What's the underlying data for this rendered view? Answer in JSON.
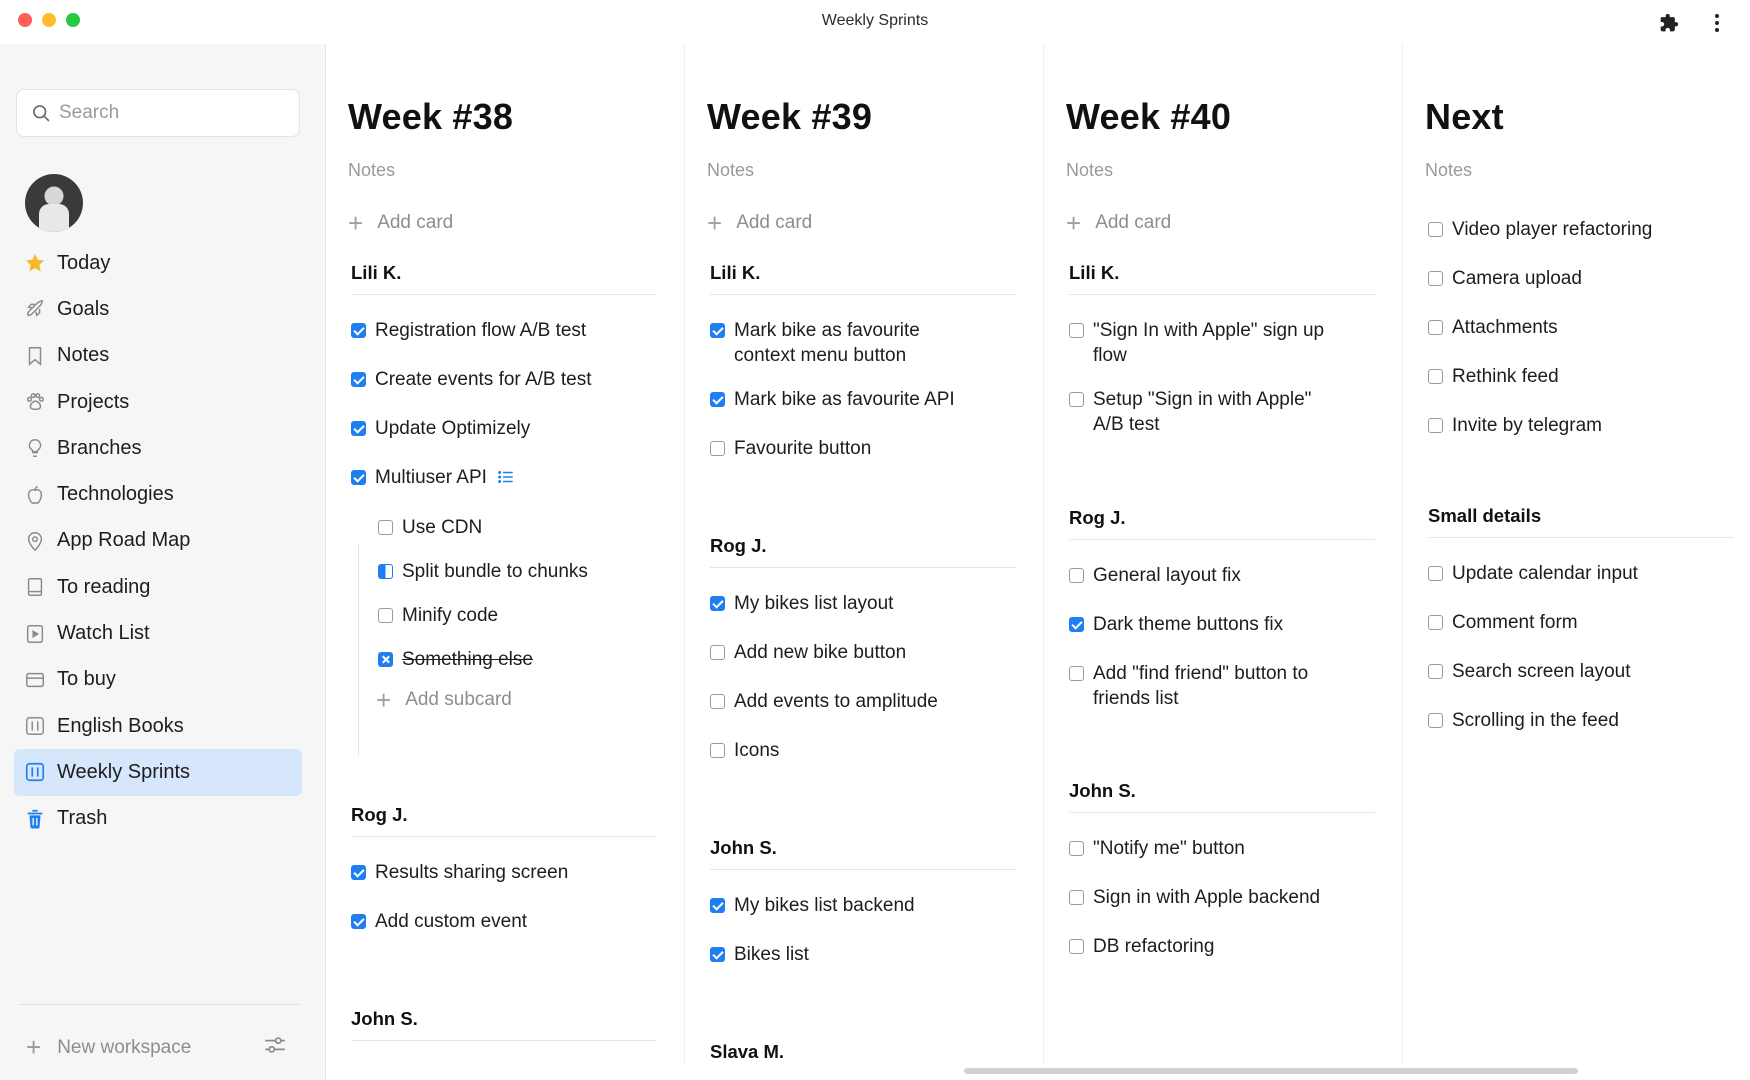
{
  "window": {
    "title": "Weekly Sprints"
  },
  "toolbar": {
    "extensions_icon": "puzzle-icon",
    "more_icon": "more-vertical-icon"
  },
  "search": {
    "placeholder": "Search"
  },
  "sidebar": {
    "items": [
      {
        "label": "Today",
        "icon": "star-icon"
      },
      {
        "label": "Goals",
        "icon": "rocket-icon"
      },
      {
        "label": "Notes",
        "icon": "bookmark-icon"
      },
      {
        "label": "Projects",
        "icon": "paw-icon"
      },
      {
        "label": "Branches",
        "icon": "lightbulb-icon"
      },
      {
        "label": "Technologies",
        "icon": "apple-icon"
      },
      {
        "label": "App Road Map",
        "icon": "map-pin-icon"
      },
      {
        "label": "To reading",
        "icon": "book-icon"
      },
      {
        "label": "Watch List",
        "icon": "play-icon"
      },
      {
        "label": "To buy",
        "icon": "credit-card-icon"
      },
      {
        "label": "English Books",
        "icon": "board-icon"
      },
      {
        "label": "Weekly Sprints",
        "icon": "board-icon",
        "active": true
      },
      {
        "label": "Trash",
        "icon": "trash-icon"
      }
    ],
    "new_workspace": "New workspace"
  },
  "accent": "#1f7ff2",
  "columns": [
    {
      "title": "Week #38",
      "notes": "Notes",
      "add_card": "Add card",
      "groups": [
        {
          "name": "Lili K.",
          "tasks": [
            {
              "text": "Registration flow A/B test",
              "state": "checked"
            },
            {
              "text": "Create events for A/B test",
              "state": "checked"
            },
            {
              "text": "Update Optimizely",
              "state": "checked"
            },
            {
              "text": "Multiuser API",
              "state": "checked",
              "has_subtasks": true
            }
          ],
          "subtasks": [
            {
              "text": "Use CDN",
              "state": "unchecked"
            },
            {
              "text": "Split bundle to chunks",
              "state": "partial"
            },
            {
              "text": "Minify code",
              "state": "unchecked"
            },
            {
              "text": "Something else",
              "state": "cancelled"
            }
          ],
          "add_subcard": "Add subcard"
        },
        {
          "name": "Rog J.",
          "tasks": [
            {
              "text": "Results sharing screen",
              "state": "checked"
            },
            {
              "text": "Add custom event",
              "state": "checked"
            }
          ]
        },
        {
          "name": "John S.",
          "tasks": []
        }
      ]
    },
    {
      "title": "Week #39",
      "notes": "Notes",
      "add_card": "Add card",
      "groups": [
        {
          "name": "Lili K.",
          "tasks": [
            {
              "text": "Mark bike as favourite context menu button",
              "state": "checked"
            },
            {
              "text": "Mark bike as favourite API",
              "state": "checked"
            },
            {
              "text": "Favourite button",
              "state": "unchecked"
            }
          ]
        },
        {
          "name": "Rog J.",
          "tasks": [
            {
              "text": "My bikes list layout",
              "state": "checked"
            },
            {
              "text": "Add new bike button",
              "state": "unchecked"
            },
            {
              "text": "Add events to amplitude",
              "state": "unchecked"
            },
            {
              "text": "Icons",
              "state": "unchecked"
            }
          ]
        },
        {
          "name": "John S.",
          "tasks": [
            {
              "text": "My bikes list backend",
              "state": "checked"
            },
            {
              "text": "Bikes list",
              "state": "checked"
            }
          ]
        },
        {
          "name": "Slava M.",
          "tasks": []
        }
      ]
    },
    {
      "title": "Week #40",
      "notes": "Notes",
      "add_card": "Add card",
      "groups": [
        {
          "name": "Lili K.",
          "tasks": [
            {
              "text": "\"Sign In with Apple\" sign up flow",
              "state": "unchecked"
            },
            {
              "text": "Setup \"Sign in with Apple\" A/B test",
              "state": "unchecked"
            }
          ]
        },
        {
          "name": "Rog J.",
          "tasks": [
            {
              "text": "General layout fix",
              "state": "unchecked"
            },
            {
              "text": "Dark theme buttons fix",
              "state": "checked"
            },
            {
              "text": "Add \"find friend\" button to friends list",
              "state": "unchecked"
            }
          ]
        },
        {
          "name": "John S.",
          "tasks": [
            {
              "text": "\"Notify me\" button",
              "state": "unchecked"
            },
            {
              "text": "Sign in with Apple backend",
              "state": "unchecked"
            },
            {
              "text": "DB refactoring",
              "state": "unchecked"
            }
          ]
        }
      ]
    },
    {
      "title": "Next",
      "notes": "Notes",
      "groups": [
        {
          "name": "",
          "tasks": [
            {
              "text": "Video player refactoring",
              "state": "unchecked"
            },
            {
              "text": "Camera upload",
              "state": "unchecked"
            },
            {
              "text": "Attachments",
              "state": "unchecked"
            },
            {
              "text": "Rethink feed",
              "state": "unchecked"
            },
            {
              "text": "Invite by telegram",
              "state": "unchecked"
            }
          ]
        },
        {
          "name": "Small details",
          "tasks": [
            {
              "text": "Update calendar input",
              "state": "unchecked"
            },
            {
              "text": "Comment form",
              "state": "unchecked"
            },
            {
              "text": "Search screen layout",
              "state": "unchecked"
            },
            {
              "text": "Scrolling in the feed",
              "state": "unchecked"
            }
          ]
        }
      ]
    }
  ]
}
